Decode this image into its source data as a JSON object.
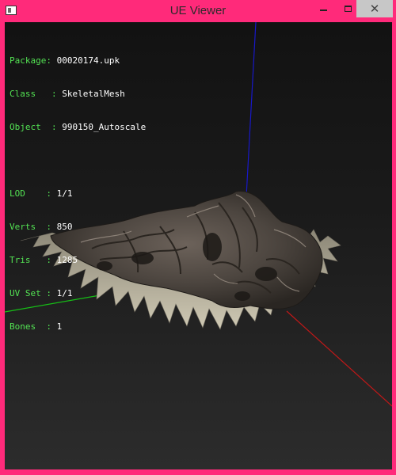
{
  "window": {
    "title": "UE Viewer",
    "controls": {
      "minimize": "minimize",
      "maximize": "maximize",
      "close": "✕"
    }
  },
  "info": {
    "package": {
      "key": "Package: ",
      "value": "00020174.upk"
    },
    "class": {
      "key": "Class   : ",
      "value": "SkeletalMesh"
    },
    "object": {
      "key": "Object  : ",
      "value": "990150_Autoscale"
    },
    "lod": {
      "key": "LOD    : ",
      "value": "1/1"
    },
    "verts": {
      "key": "Verts  : ",
      "value": "850"
    },
    "tris": {
      "key": "Tris   : ",
      "value": "1285"
    },
    "uvset": {
      "key": "UV Set : ",
      "value": "1/1"
    },
    "bones": {
      "key": "Bones  : ",
      "value": "1"
    }
  },
  "colors": {
    "frame": "#ff2a7a",
    "label": "#53e253",
    "value": "#ffffff",
    "axis_x": "#c01818",
    "axis_y": "#16c016",
    "axis_z": "#1818c8"
  }
}
